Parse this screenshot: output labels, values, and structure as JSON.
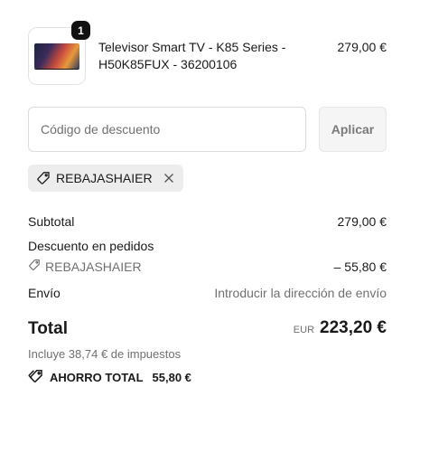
{
  "product": {
    "quantity": "1",
    "name": "Televisor Smart TV - K85 Series - H50K85FUX - 36200106",
    "price": "279,00 €"
  },
  "discount": {
    "placeholder": "Código de descuento",
    "apply_label": "Aplicar",
    "applied_code": "REBAJASHAIER"
  },
  "summary": {
    "subtotal_label": "Subtotal",
    "subtotal_value": "279,00 €",
    "order_discount_label": "Descuento en pedidos",
    "order_discount_code": "REBAJASHAIER",
    "order_discount_value": "– 55,80 €",
    "shipping_label": "Envío",
    "shipping_value": "Introducir la dirección de envío",
    "total_label": "Total",
    "total_currency": "EUR",
    "total_value": "223,20 €",
    "taxes_note": "Incluye 38,74 € de impuestos",
    "savings_label": "AHORRO TOTAL",
    "savings_value": "55,80 €"
  },
  "icons": {
    "tag": "tag-icon",
    "close": "close-icon",
    "savings": "savings-tag-icon"
  }
}
